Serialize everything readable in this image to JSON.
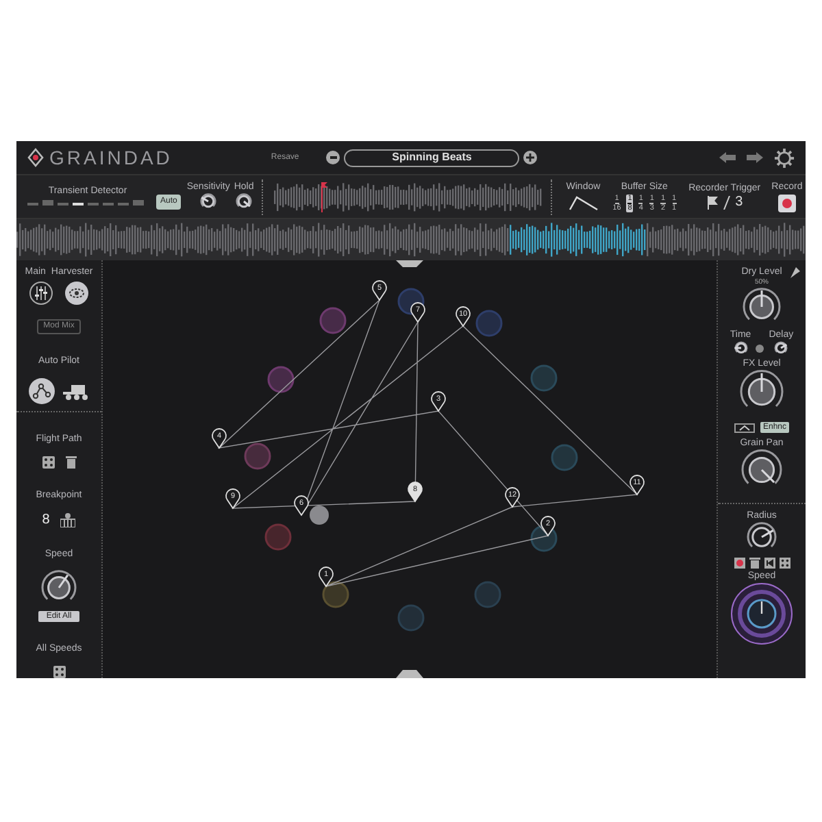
{
  "header": {
    "logo": "GRAINDAD",
    "preset_label": "Resave",
    "preset_name": "Spinning Beats"
  },
  "controls": {
    "transient_detector": {
      "label": "Transient Detector"
    },
    "auto": {
      "label": "Auto",
      "on": true
    },
    "sensitivity": {
      "label": "Sensitivity"
    },
    "hold": {
      "label": "Hold"
    },
    "window": {
      "label": "Window"
    },
    "buffer_size": {
      "label": "Buffer Size",
      "options": [
        {
          "num": "1",
          "den": "16",
          "selected": false
        },
        {
          "num": "1",
          "den": "8",
          "selected": true
        },
        {
          "num": "1",
          "den": "4",
          "selected": false
        },
        {
          "num": "1",
          "den": "3",
          "selected": false
        },
        {
          "num": "1",
          "den": "2",
          "selected": false
        },
        {
          "num": "1",
          "den": "1",
          "selected": false
        }
      ]
    },
    "recorder_trigger": {
      "label": "Recorder Trigger",
      "value": "3"
    },
    "record": {
      "label": "Record",
      "armed": true
    }
  },
  "left_panel": {
    "main": "Main",
    "harvester": "Harvester",
    "mod_mix": "Mod Mix",
    "auto_pilot": "Auto Pilot",
    "flight_path": "Flight Path",
    "breakpoint": {
      "label": "Breakpoint",
      "value": "8"
    },
    "speed": "Speed",
    "edit_all": "Edit All",
    "all_speeds": "All Speeds"
  },
  "right_panel": {
    "dry_level": {
      "label": "Dry Level",
      "value": "50%"
    },
    "time": "Time",
    "delay": "Delay",
    "fx_level": "FX Level",
    "enhance": {
      "label": "Enhnc",
      "on": true
    },
    "grain_pan": "Grain Pan",
    "radius": "Radius",
    "speed": "Speed"
  },
  "canvas": {
    "breakpoints": [
      {
        "label": "1",
        "selected": false
      },
      {
        "label": "2",
        "selected": false
      },
      {
        "label": "3",
        "selected": false
      },
      {
        "label": "4",
        "selected": false
      },
      {
        "label": "5",
        "selected": false
      },
      {
        "label": "6",
        "selected": false
      },
      {
        "label": "7",
        "selected": false
      },
      {
        "label": "8",
        "selected": true
      },
      {
        "label": "9",
        "selected": false
      },
      {
        "label": "10",
        "selected": false
      },
      {
        "label": "11",
        "selected": false
      },
      {
        "label": "12",
        "selected": false
      }
    ]
  }
}
